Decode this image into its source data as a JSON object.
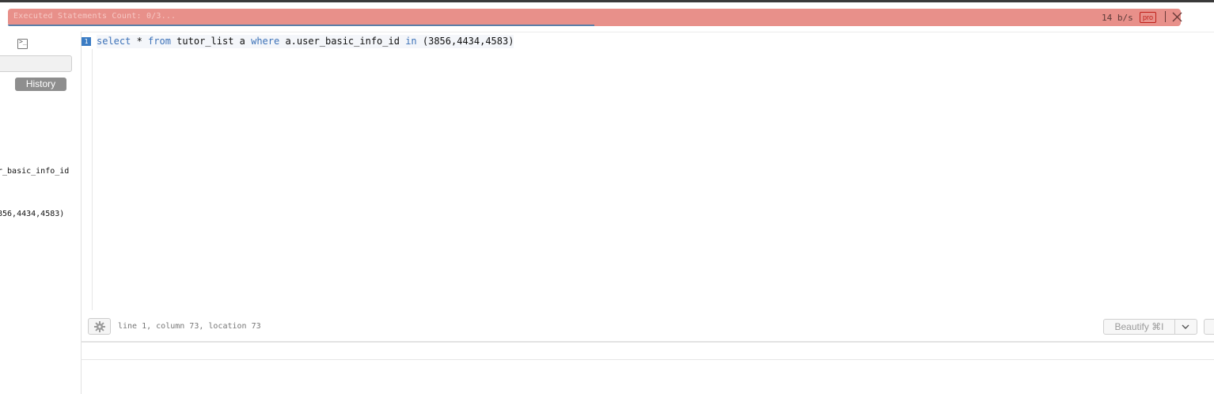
{
  "banner": {
    "status_text": "Executed Statements Count: 0/3...",
    "progress": 0.5,
    "rate": "14 b/s",
    "pro_badge": "pro",
    "background_color": "#e8908a"
  },
  "sidebar": {
    "terminal_icon": "terminal-icon",
    "filter_value": "",
    "history_label": "History",
    "history_fragments": [
      "r_basic_info_id",
      "856,4434,4583)"
    ]
  },
  "editor": {
    "line_number": "1",
    "code_tokens": [
      {
        "t": "select",
        "kw": true
      },
      {
        "t": " * ",
        "kw": false
      },
      {
        "t": "from",
        "kw": true
      },
      {
        "t": " tutor_list a ",
        "kw": false
      },
      {
        "t": "where",
        "kw": true
      },
      {
        "t": " a.user_basic_info_id ",
        "kw": false
      },
      {
        "t": "in",
        "kw": true
      },
      {
        "t": " (3856,4434,4583)",
        "kw": false
      }
    ],
    "keyword_color": "#3d72b8",
    "status": "line 1, column 73, location 73",
    "beautify_label": "Beautify ⌘I"
  }
}
